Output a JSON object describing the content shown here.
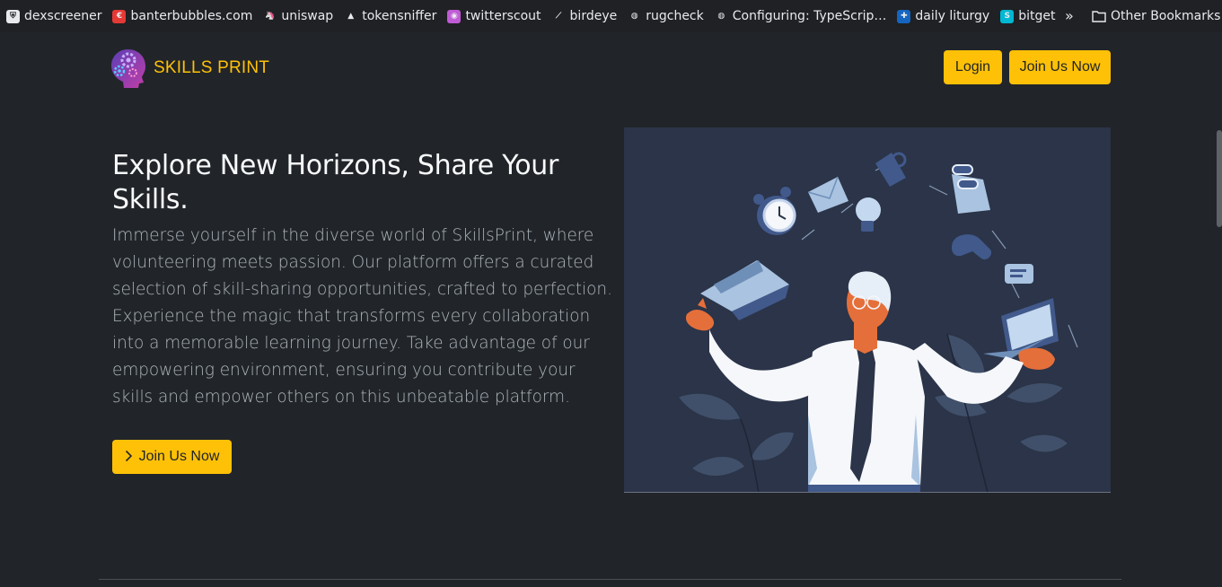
{
  "bookmarks": [
    {
      "label": "dexscreener",
      "color": "#e8eaed",
      "glyph": "⛨"
    },
    {
      "label": "banterbubbles.com",
      "color": "#e53935",
      "glyph": "€"
    },
    {
      "label": "uniswap",
      "color": "#202124",
      "glyph": "🦄"
    },
    {
      "label": "tokensniffer",
      "color": "#202124",
      "glyph": "▲"
    },
    {
      "label": "twitterscout",
      "color": "#c05bd6",
      "glyph": "◉"
    },
    {
      "label": "birdeye",
      "color": "#202124",
      "glyph": "⟋"
    },
    {
      "label": "rugcheck",
      "color": "#202124",
      "glyph": "◍"
    },
    {
      "label": "Configuring: TypeScrip…",
      "color": "#202124",
      "glyph": "◍"
    },
    {
      "label": "daily liturgy",
      "color": "#1565c0",
      "glyph": "✚"
    },
    {
      "label": "bitget",
      "color": "#00b8d4",
      "glyph": "S"
    }
  ],
  "other_bookmarks": "Other Bookmarks",
  "header": {
    "brand": "SKILLS PRINT",
    "login_label": "Login",
    "join_label": "Join Us Now"
  },
  "hero": {
    "title": "Explore New Horizons, Share Your Skills.",
    "description": "Immerse yourself in the diverse world of SkillsPrint, where volunteering meets passion. Our platform offers a curated selection of skill-sharing opportunities, crafted to perfection. Experience the magic that transforms every collaboration into a memorable learning journey. Take advantage of our empowering environment, ensuring you contribute your skills and empower others on this unbeatable platform.",
    "cta_label": "Join Us Now"
  },
  "colors": {
    "accent": "#ffc107",
    "background": "#212529",
    "illustration_bg": "#2b3448"
  }
}
